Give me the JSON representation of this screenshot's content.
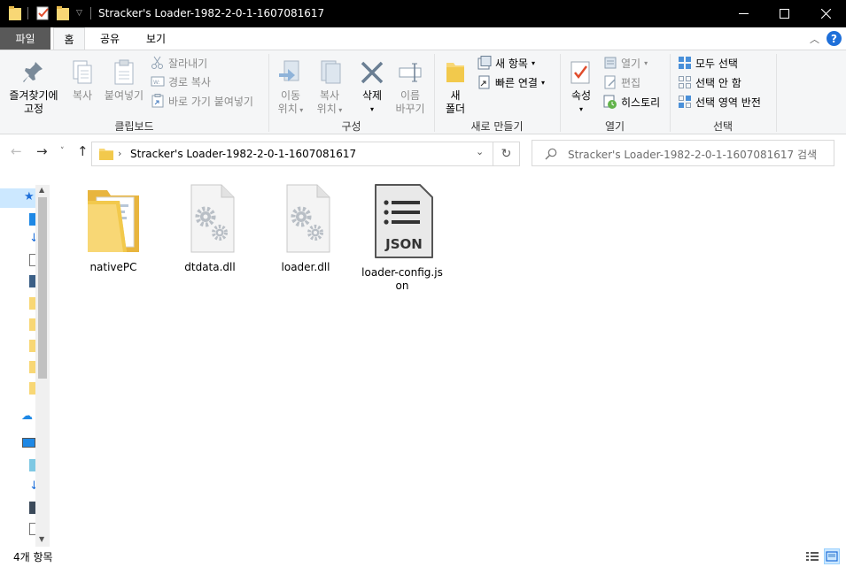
{
  "window": {
    "title": "Stracker's Loader-1982-2-0-1-1607081617",
    "buttons": {
      "minimize_icon": "minimize-icon",
      "maximize_icon": "maximize-icon",
      "close_icon": "close-icon"
    }
  },
  "tabs": {
    "file": "파일",
    "home": "홈",
    "share": "공유",
    "view": "보기"
  },
  "ribbon": {
    "clipboard": {
      "label": "클립보드",
      "pin_line1": "즐겨찾기에",
      "pin_line2": "고정",
      "copy": "복사",
      "paste": "붙여넣기",
      "cut": "잘라내기",
      "copy_path": "경로 복사",
      "paste_shortcut": "바로 가기 붙여넣기"
    },
    "organize": {
      "label": "구성",
      "move_to_1": "이동",
      "move_to_2": "위치",
      "copy_to_1": "복사",
      "copy_to_2": "위치",
      "delete": "삭제",
      "rename_1": "이름",
      "rename_2": "바꾸기"
    },
    "new": {
      "label": "새로 만들기",
      "folder_1": "새",
      "folder_2": "폴더",
      "new_item": "새 항목",
      "easy_access": "빠른 연결"
    },
    "open": {
      "label": "열기",
      "properties": "속성",
      "open": "열기",
      "edit": "편집",
      "history": "히스토리"
    },
    "select": {
      "label": "선택",
      "select_all": "모두 선택",
      "select_none": "선택 안 함",
      "invert": "선택 영역 반전"
    }
  },
  "address": {
    "path": "Stracker's Loader-1982-2-0-1-1607081617",
    "search_placeholder": "Stracker's Loader-1982-2-0-1-1607081617 검색"
  },
  "files": [
    {
      "name": "nativePC",
      "type": "folder"
    },
    {
      "name": "dtdata.dll",
      "type": "dll"
    },
    {
      "name": "loader.dll",
      "type": "dll"
    },
    {
      "name": "loader-config.json",
      "type": "json",
      "badge": "JSON"
    }
  ],
  "status": {
    "item_count": "4개 항목"
  },
  "colors": {
    "accent": "#0078d7",
    "folder": "#f8d775",
    "file_tab": "#595959",
    "selection": "#cce8ff"
  }
}
